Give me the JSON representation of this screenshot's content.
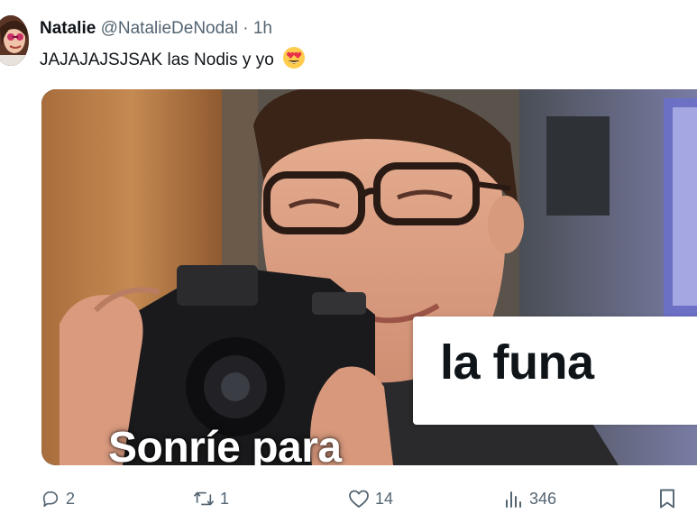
{
  "tweet": {
    "author_name": "Natalie",
    "handle": "@NatalieDeNodal",
    "separator": "·",
    "time": "1h",
    "text": "JAJAJAJSJSAK las Nodis y yo",
    "emoji": "smiling-face-with-heart-eyes"
  },
  "media": {
    "caption_left": "Sonríe para",
    "caption_right": "la funa"
  },
  "actions": {
    "replies": "2",
    "reposts": "1",
    "likes": "14",
    "views": "346"
  },
  "colors": {
    "text_primary": "#0f1419",
    "text_secondary": "#536471",
    "background": "#ffffff"
  }
}
